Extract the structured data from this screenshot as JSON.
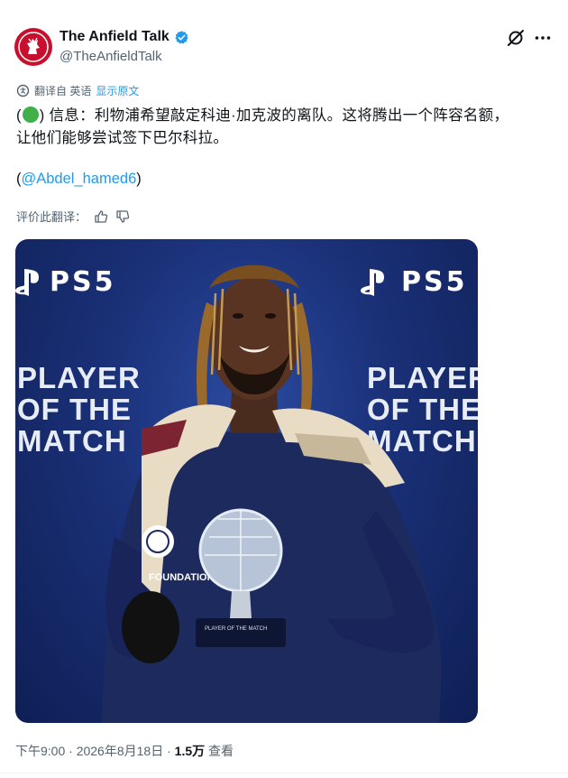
{
  "account": {
    "display_name": "The Anfield Talk",
    "handle": "@TheAnfieldTalk"
  },
  "translation": {
    "translated_from": "翻译自 英语",
    "show_original": "显示原文"
  },
  "tweet": {
    "open_paren": "(",
    "close_paren": ")",
    "line1_text": " 信息：利物浦希望敲定科迪·加克波的离队。这将腾出一个阵容名额，",
    "line2_text": "让他们能够尝试签下巴尔科拉。",
    "mention_open": "(",
    "mention": "@Abdel_hamed6",
    "mention_close": ")"
  },
  "rating": {
    "label": "评价此翻译："
  },
  "photo": {
    "sponsor": "PS5",
    "potm_lines": [
      "PLAYER",
      "OF THE",
      "MATCH"
    ],
    "towel_text": "FOUNDATION",
    "trophy_caption": "PLAYER OF THE MATCH"
  },
  "meta": {
    "time": "下午9:00",
    "separator": " · ",
    "date": "2026年8月18日",
    "views_count": "1.5万",
    "views_label": "查看"
  },
  "icons": [
    "liverbird-icon",
    "verified-icon",
    "grok-icon",
    "more-icon",
    "translate-icon",
    "thumbs-up-icon",
    "thumbs-down-icon",
    "playstation-icon"
  ],
  "colors": {
    "verified": "#1d9bf0",
    "link": "#1d9bf0",
    "avatar": "#c8102e",
    "secondary_text": "#536471"
  }
}
